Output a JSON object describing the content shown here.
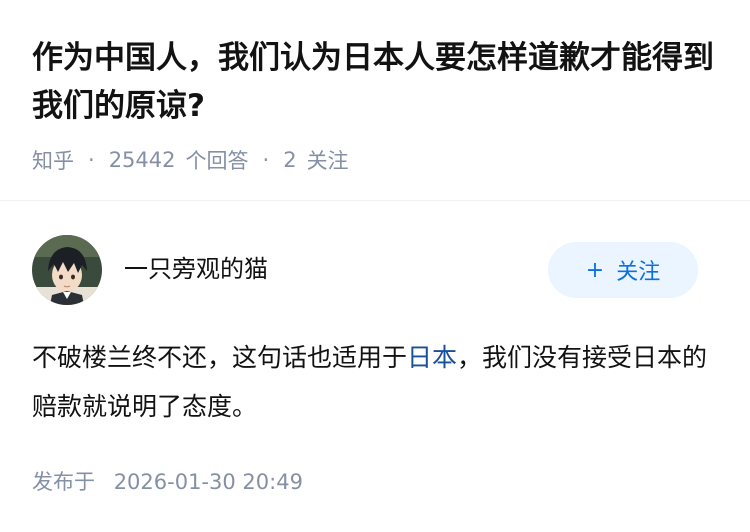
{
  "question": {
    "title": "作为中国人，我们认为日本人要怎样道歉才能得到我们的原谅?"
  },
  "meta": {
    "source": "知乎",
    "separator": "·",
    "answer_count": "25442",
    "answer_label": "个回答",
    "follow_count": "2",
    "follow_label": "关注"
  },
  "answer": {
    "author_name": "一只旁观的猫",
    "follow_button": {
      "plus": "+",
      "label": "关注"
    },
    "content": {
      "before_link": "不破楼兰终不还，这句话也适用于",
      "link_text": "日本",
      "after_link": "，我们没有接受日本的赔款就说明了态度。"
    },
    "published_label": "发布于",
    "published_date": "2026-01-30 20:49"
  },
  "colors": {
    "accent": "#0b70e0",
    "link": "#175199",
    "meta": "#8590a6",
    "follow_bg": "#ebf5ff"
  }
}
